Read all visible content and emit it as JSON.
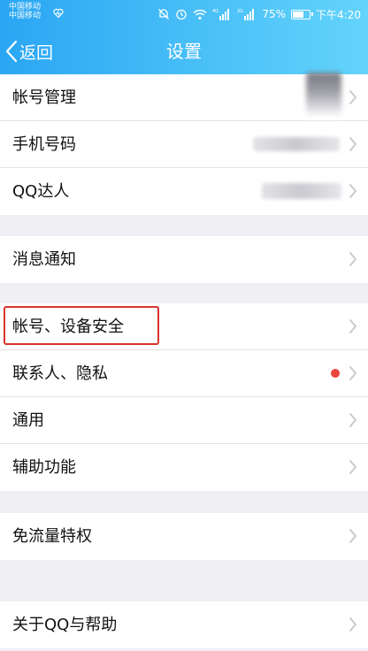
{
  "status_bar": {
    "carrier_line1": "中国移动",
    "carrier_line2": "中国移动",
    "battery_percent": "75%",
    "battery_level": 0.75,
    "time": "下午4:20",
    "network_label_1": "4G",
    "network_label_2": "2G"
  },
  "nav": {
    "back_label": "返回",
    "title": "设置"
  },
  "groups": [
    {
      "items": [
        {
          "label": "帐号管理"
        },
        {
          "label": "手机号码"
        },
        {
          "label": "QQ达人"
        }
      ]
    },
    {
      "items": [
        {
          "label": "消息通知"
        }
      ]
    },
    {
      "items": [
        {
          "label": "帐号、设备安全"
        },
        {
          "label": "联系人、隐私"
        },
        {
          "label": "通用"
        },
        {
          "label": "辅助功能"
        }
      ]
    },
    {
      "items": [
        {
          "label": "免流量特权"
        }
      ]
    },
    {
      "items": [
        {
          "label": "关于QQ与帮助"
        }
      ]
    }
  ],
  "colors": {
    "header_start": "#2aa6f3",
    "header_end": "#63d4fb",
    "page_background": "#efeff4",
    "highlight": "#d9332d",
    "notification_dot": "#e9473e"
  },
  "icons": {
    "back": "chevron-left-icon",
    "row_arrow": "chevron-right-icon",
    "status": [
      "heart-icon",
      "mute-icon",
      "alarm-icon",
      "wifi-icon",
      "signal-icon",
      "battery-icon"
    ]
  }
}
